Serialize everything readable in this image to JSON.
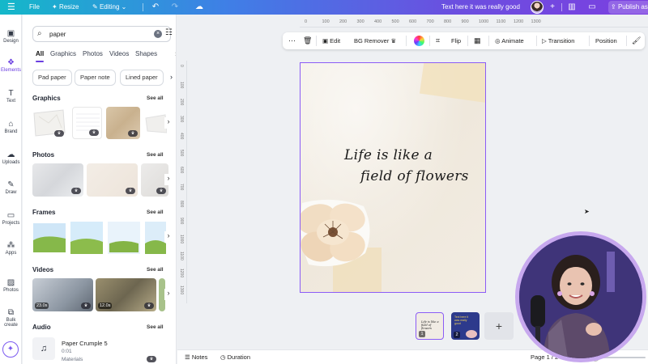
{
  "topbar": {
    "menu_icon": "hamburger-icon",
    "file": "File",
    "resize": "Resize",
    "editing": "Editing",
    "doc_title": "Text here it was really good",
    "publish": "Publish as"
  },
  "rail": {
    "items": [
      {
        "label": "Design",
        "icon": "layout-icon"
      },
      {
        "label": "Elements",
        "icon": "shapes-icon"
      },
      {
        "label": "Text",
        "icon": "text-icon"
      },
      {
        "label": "Brand",
        "icon": "briefcase-icon"
      },
      {
        "label": "Uploads",
        "icon": "cloud-upload-icon"
      },
      {
        "label": "Draw",
        "icon": "pen-icon"
      },
      {
        "label": "Projects",
        "icon": "folder-icon"
      },
      {
        "label": "Apps",
        "icon": "apps-icon"
      },
      {
        "label": "Photos",
        "icon": "image-icon"
      },
      {
        "label": "Bulk create",
        "icon": "bulk-icon"
      }
    ]
  },
  "panel": {
    "search": {
      "value": "paper"
    },
    "tabs": [
      "All",
      "Graphics",
      "Photos",
      "Videos",
      "Shapes"
    ],
    "chips": [
      "Pad paper",
      "Paper note",
      "Lined paper"
    ],
    "sections": {
      "graphics": "Graphics",
      "photos": "Photos",
      "frames": "Frames",
      "videos": "Videos",
      "audio": "Audio"
    },
    "see_all": "See all",
    "videos": [
      {
        "duration": "23.0s"
      },
      {
        "duration": "12.0s"
      }
    ],
    "audio": {
      "title": "Paper Crumple 5",
      "duration": "0:01",
      "category": "Materials"
    }
  },
  "ruler": {
    "h": [
      "0",
      "100",
      "200",
      "300",
      "400",
      "500",
      "600",
      "700",
      "800",
      "900",
      "1000",
      "1100",
      "1200",
      "1300"
    ],
    "v": [
      "0",
      "100",
      "200",
      "300",
      "400",
      "500",
      "600",
      "700",
      "800",
      "900",
      "1000",
      "1100",
      "1200",
      "1300"
    ]
  },
  "context_toolbar": {
    "edit": "Edit",
    "bg_remover": "BG Remover",
    "flip": "Flip",
    "animate": "Animate",
    "transition": "Transition",
    "position": "Position"
  },
  "canvas": {
    "line1": "Life is like a",
    "line2": "field of flowers"
  },
  "pages": {
    "thumbs": [
      {
        "num": "1",
        "text": "Life is like a field of flowers"
      },
      {
        "num": "2",
        "text": "Text here it was really good"
      }
    ]
  },
  "bottombar": {
    "notes": "Notes",
    "duration": "Duration",
    "page_indicator": "Page 1 / 2",
    "zoom_fraction": 0.38
  }
}
